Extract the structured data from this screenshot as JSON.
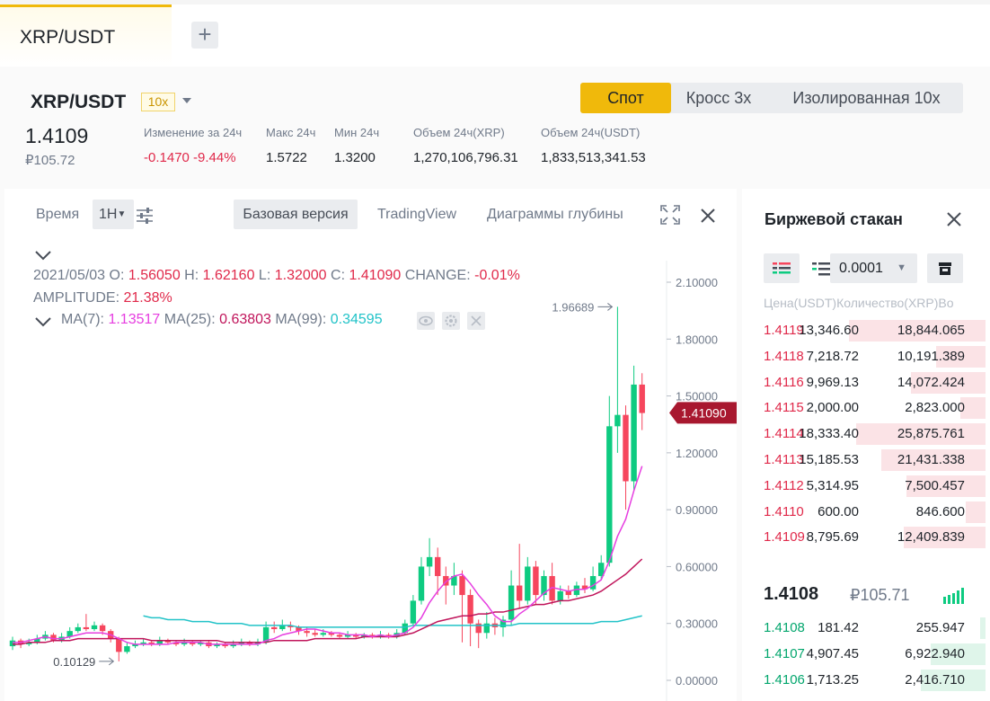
{
  "tabs": {
    "active": "XRP/USDT",
    "add": "+"
  },
  "header": {
    "pair": "XRP/USDT",
    "leverage": "10x",
    "price": "1.4109",
    "price_rub": "₽105.72",
    "stats": [
      {
        "label": "Изменение за 24ч",
        "value": "-0.1470 -9.44%",
        "color": "#e0294a"
      },
      {
        "label": "Макс 24ч",
        "value": "1.5722",
        "color": "#1e2329"
      },
      {
        "label": "Мин 24ч",
        "value": "1.3200",
        "color": "#1e2329"
      },
      {
        "label": "Объем 24ч(XRP)",
        "value": "1,270,106,796.31",
        "color": "#1e2329"
      },
      {
        "label": "Объем 24ч(USDT)",
        "value": "1,833,513,341.53",
        "color": "#1e2329"
      }
    ],
    "modes": {
      "spot": "Спот",
      "cross": "Кросс",
      "cross_x": "3x",
      "isolated": "Изолированная",
      "isolated_x": "10x"
    }
  },
  "chart_toolbar": {
    "time": "Время",
    "interval": "1H",
    "basic": "Базовая версия",
    "tradingview": "TradingView",
    "depth": "Диаграммы глубины"
  },
  "chart_legend": {
    "date": "2021/05/03",
    "o_label": "O:",
    "o": "1.56050",
    "h_label": "H:",
    "h": "1.62160",
    "l_label": "L:",
    "l": "1.32000",
    "c_label": "C:",
    "c": "1.41090",
    "change_label": "CHANGE:",
    "change": "-0.01%",
    "amp_label": "AMPLITUDE:",
    "amp": "21.38%",
    "ma7_label": "MA(7):",
    "ma7": "1.13517",
    "ma25_label": "MA(25):",
    "ma25": "0.63803",
    "ma99_label": "MA(99):",
    "ma99": "0.34595"
  },
  "chart_data": {
    "type": "candlestick",
    "yaxis_ticks": [
      "2.10000",
      "1.80000",
      "1.50000",
      "1.20000",
      "0.90000",
      "0.60000",
      "0.30000",
      "0.00000"
    ],
    "ylim": [
      0,
      2.1
    ],
    "current_price": "1.41090",
    "max_label": "1.96689",
    "min_label": "0.10129",
    "colors": {
      "up": "#0ecb81",
      "down": "#f6465d",
      "ma7": "#e63ee0",
      "ma25": "#c0155b",
      "ma99": "#22c3c8"
    },
    "candles": [
      [
        0.18,
        0.21,
        0.23,
        0.16
      ],
      [
        0.21,
        0.19,
        0.22,
        0.17
      ],
      [
        0.19,
        0.2,
        0.22,
        0.18
      ],
      [
        0.2,
        0.22,
        0.24,
        0.19
      ],
      [
        0.22,
        0.24,
        0.26,
        0.21
      ],
      [
        0.24,
        0.21,
        0.25,
        0.2
      ],
      [
        0.21,
        0.23,
        0.25,
        0.2
      ],
      [
        0.23,
        0.26,
        0.28,
        0.22
      ],
      [
        0.26,
        0.28,
        0.3,
        0.25
      ],
      [
        0.28,
        0.27,
        0.35,
        0.26
      ],
      [
        0.27,
        0.29,
        0.31,
        0.26
      ],
      [
        0.29,
        0.26,
        0.3,
        0.24
      ],
      [
        0.26,
        0.22,
        0.27,
        0.2
      ],
      [
        0.22,
        0.15,
        0.23,
        0.1
      ],
      [
        0.15,
        0.18,
        0.2,
        0.14
      ],
      [
        0.18,
        0.19,
        0.21,
        0.17
      ],
      [
        0.19,
        0.2,
        0.22,
        0.18
      ],
      [
        0.2,
        0.19,
        0.21,
        0.18
      ],
      [
        0.19,
        0.21,
        0.23,
        0.18
      ],
      [
        0.21,
        0.2,
        0.22,
        0.19
      ],
      [
        0.2,
        0.19,
        0.21,
        0.18
      ],
      [
        0.19,
        0.2,
        0.22,
        0.18
      ],
      [
        0.2,
        0.19,
        0.21,
        0.18
      ],
      [
        0.19,
        0.2,
        0.21,
        0.18
      ],
      [
        0.2,
        0.18,
        0.21,
        0.17
      ],
      [
        0.18,
        0.19,
        0.2,
        0.17
      ],
      [
        0.19,
        0.18,
        0.2,
        0.17
      ],
      [
        0.18,
        0.19,
        0.21,
        0.17
      ],
      [
        0.19,
        0.2,
        0.22,
        0.18
      ],
      [
        0.2,
        0.19,
        0.21,
        0.18
      ],
      [
        0.19,
        0.2,
        0.22,
        0.18
      ],
      [
        0.2,
        0.28,
        0.31,
        0.19
      ],
      [
        0.28,
        0.27,
        0.31,
        0.25
      ],
      [
        0.27,
        0.29,
        0.32,
        0.26
      ],
      [
        0.29,
        0.28,
        0.31,
        0.26
      ],
      [
        0.28,
        0.26,
        0.29,
        0.24
      ],
      [
        0.26,
        0.25,
        0.28,
        0.23
      ],
      [
        0.25,
        0.24,
        0.27,
        0.23
      ],
      [
        0.24,
        0.25,
        0.27,
        0.23
      ],
      [
        0.25,
        0.24,
        0.26,
        0.23
      ],
      [
        0.24,
        0.23,
        0.25,
        0.22
      ],
      [
        0.23,
        0.24,
        0.26,
        0.22
      ],
      [
        0.24,
        0.23,
        0.25,
        0.22
      ],
      [
        0.23,
        0.24,
        0.25,
        0.22
      ],
      [
        0.24,
        0.23,
        0.25,
        0.22
      ],
      [
        0.23,
        0.24,
        0.26,
        0.22
      ],
      [
        0.24,
        0.23,
        0.25,
        0.22
      ],
      [
        0.23,
        0.25,
        0.27,
        0.22
      ],
      [
        0.25,
        0.3,
        0.32,
        0.24
      ],
      [
        0.3,
        0.42,
        0.45,
        0.29
      ],
      [
        0.42,
        0.6,
        0.65,
        0.4
      ],
      [
        0.6,
        0.65,
        0.75,
        0.55
      ],
      [
        0.65,
        0.55,
        0.7,
        0.45
      ],
      [
        0.55,
        0.5,
        0.6,
        0.4
      ],
      [
        0.5,
        0.55,
        0.62,
        0.45
      ],
      [
        0.55,
        0.45,
        0.58,
        0.2
      ],
      [
        0.45,
        0.3,
        0.48,
        0.18
      ],
      [
        0.3,
        0.25,
        0.32,
        0.17
      ],
      [
        0.25,
        0.3,
        0.36,
        0.22
      ],
      [
        0.3,
        0.28,
        0.33,
        0.24
      ],
      [
        0.28,
        0.32,
        0.34,
        0.23
      ],
      [
        0.32,
        0.5,
        0.58,
        0.29
      ],
      [
        0.5,
        0.42,
        0.72,
        0.38
      ],
      [
        0.42,
        0.6,
        0.65,
        0.4
      ],
      [
        0.6,
        0.45,
        0.63,
        0.4
      ],
      [
        0.45,
        0.55,
        0.58,
        0.42
      ],
      [
        0.55,
        0.42,
        0.62,
        0.4
      ],
      [
        0.42,
        0.47,
        0.5,
        0.4
      ],
      [
        0.47,
        0.45,
        0.5,
        0.43
      ],
      [
        0.45,
        0.5,
        0.52,
        0.44
      ],
      [
        0.5,
        0.48,
        0.54,
        0.46
      ],
      [
        0.48,
        0.55,
        0.6,
        0.47
      ],
      [
        0.55,
        0.62,
        0.66,
        0.53
      ],
      [
        0.62,
        1.34,
        1.5,
        0.6
      ],
      [
        1.34,
        1.4,
        1.97,
        1.2
      ],
      [
        1.4,
        1.05,
        1.45,
        0.9
      ],
      [
        1.05,
        1.56,
        1.66,
        1.0
      ],
      [
        1.56,
        1.41,
        1.62,
        1.32
      ]
    ],
    "ma7": [
      0.2,
      0.2,
      0.21,
      0.22,
      0.23,
      0.22,
      0.22,
      0.23,
      0.24,
      0.25,
      0.25,
      0.25,
      0.24,
      0.22,
      0.2,
      0.19,
      0.19,
      0.19,
      0.19,
      0.19,
      0.2,
      0.2,
      0.2,
      0.2,
      0.19,
      0.19,
      0.19,
      0.19,
      0.19,
      0.19,
      0.19,
      0.21,
      0.22,
      0.24,
      0.25,
      0.26,
      0.27,
      0.27,
      0.26,
      0.25,
      0.25,
      0.24,
      0.24,
      0.24,
      0.23,
      0.24,
      0.23,
      0.24,
      0.25,
      0.28,
      0.33,
      0.41,
      0.47,
      0.52,
      0.55,
      0.56,
      0.51,
      0.45,
      0.4,
      0.34,
      0.31,
      0.31,
      0.35,
      0.38,
      0.42,
      0.46,
      0.49,
      0.48,
      0.47,
      0.48,
      0.48,
      0.5,
      0.53,
      0.63,
      0.76,
      0.85,
      1.0,
      1.13
    ],
    "ma25": [
      0.19,
      0.19,
      0.2,
      0.2,
      0.2,
      0.21,
      0.21,
      0.21,
      0.22,
      0.22,
      0.22,
      0.22,
      0.22,
      0.22,
      0.22,
      0.22,
      0.22,
      0.21,
      0.21,
      0.21,
      0.21,
      0.21,
      0.21,
      0.21,
      0.21,
      0.21,
      0.2,
      0.2,
      0.2,
      0.2,
      0.2,
      0.2,
      0.21,
      0.21,
      0.21,
      0.21,
      0.21,
      0.22,
      0.22,
      0.22,
      0.22,
      0.22,
      0.22,
      0.23,
      0.23,
      0.23,
      0.23,
      0.23,
      0.24,
      0.25,
      0.27,
      0.29,
      0.31,
      0.32,
      0.33,
      0.34,
      0.34,
      0.35,
      0.35,
      0.36,
      0.36,
      0.37,
      0.38,
      0.39,
      0.4,
      0.4,
      0.41,
      0.42,
      0.42,
      0.43,
      0.44,
      0.45,
      0.47,
      0.5,
      0.53,
      0.56,
      0.6,
      0.64
    ],
    "ma99_start": 16,
    "ma99": [
      0.34,
      0.33,
      0.33,
      0.32,
      0.32,
      0.32,
      0.31,
      0.31,
      0.31,
      0.3,
      0.3,
      0.3,
      0.3,
      0.29,
      0.29,
      0.29,
      0.29,
      0.29,
      0.29,
      0.28,
      0.28,
      0.28,
      0.28,
      0.28,
      0.28,
      0.28,
      0.28,
      0.28,
      0.28,
      0.28,
      0.28,
      0.28,
      0.28,
      0.29,
      0.29,
      0.29,
      0.29,
      0.29,
      0.29,
      0.29,
      0.29,
      0.29,
      0.29,
      0.29,
      0.29,
      0.29,
      0.3,
      0.3,
      0.3,
      0.3,
      0.3,
      0.3,
      0.3,
      0.3,
      0.3,
      0.3,
      0.31,
      0.31,
      0.31,
      0.32,
      0.33,
      0.34
    ]
  },
  "orderbook": {
    "title": "Биржевой стакан",
    "precision": "0.0001",
    "col_price": "Цена(USDT)",
    "col_qty": "Количество(XRP)",
    "col_vol": "Во",
    "asks": [
      {
        "price": "1.4119",
        "qty": "13,346.60",
        "total": "18,844.065",
        "depth": 0.55
      },
      {
        "price": "1.4118",
        "qty": "7,218.72",
        "total": "10,191.389",
        "depth": 0.2
      },
      {
        "price": "1.4116",
        "qty": "9,969.13",
        "total": "14,072.424",
        "depth": 0.3
      },
      {
        "price": "1.4115",
        "qty": "2,000.00",
        "total": "2,823.000",
        "depth": 0.1
      },
      {
        "price": "1.4114",
        "qty": "18,333.40",
        "total": "25,875.761",
        "depth": 0.52
      },
      {
        "price": "1.4113",
        "qty": "15,185.53",
        "total": "21,431.338",
        "depth": 0.42
      },
      {
        "price": "1.4112",
        "qty": "5,314.95",
        "total": "7,500.457",
        "depth": 0.32
      },
      {
        "price": "1.4110",
        "qty": "600.00",
        "total": "846.600",
        "depth": 0.08
      },
      {
        "price": "1.4109",
        "qty": "8,795.69",
        "total": "12,409.839",
        "depth": 0.33
      }
    ],
    "last_price": "1.4108",
    "last_price_rub": "₽105.71",
    "bids": [
      {
        "price": "1.4108",
        "qty": "181.42",
        "total": "255.947",
        "depth": 0.02
      },
      {
        "price": "1.4107",
        "qty": "4,907.45",
        "total": "6,922.940",
        "depth": 0.22
      },
      {
        "price": "1.4106",
        "qty": "1,713.25",
        "total": "2,416.710",
        "depth": 0.26
      }
    ]
  }
}
